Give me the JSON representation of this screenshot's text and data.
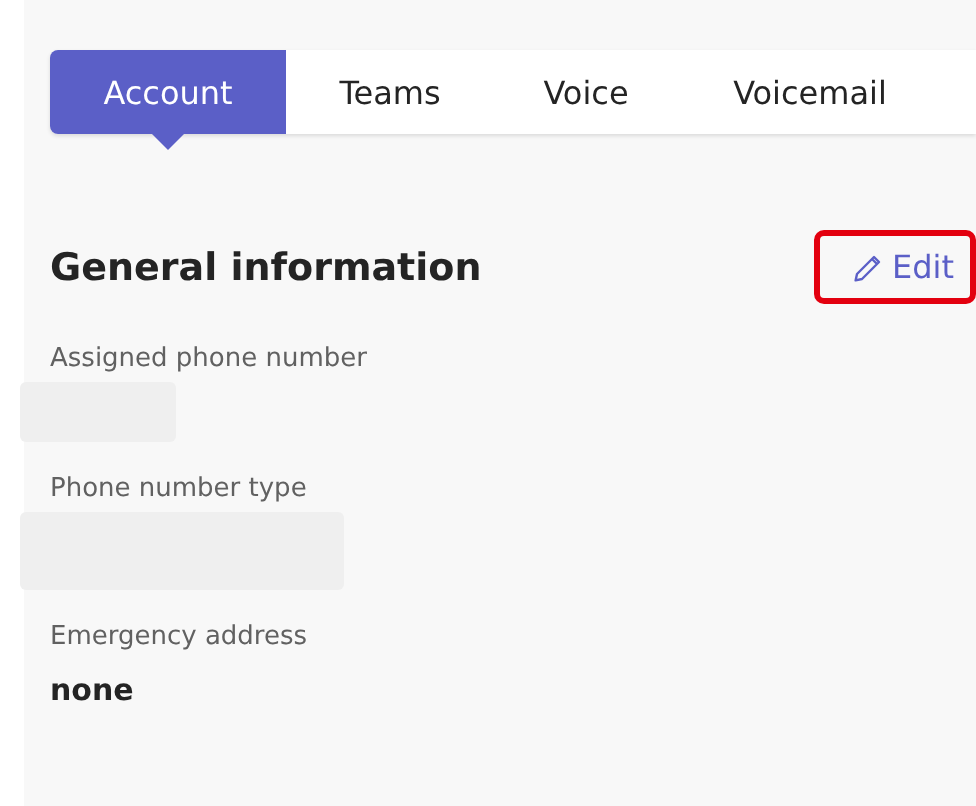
{
  "tabs": [
    {
      "label": "Account",
      "selected": true
    },
    {
      "label": "Teams",
      "selected": false
    },
    {
      "label": "Voice",
      "selected": false
    },
    {
      "label": "Voicemail",
      "selected": false
    }
  ],
  "section": {
    "title": "General information",
    "edit_button": {
      "label": "Edit",
      "highlighted": true
    }
  },
  "fields": [
    {
      "label": "Assigned phone number",
      "kind": "redacted"
    },
    {
      "label": "Phone number type",
      "kind": "redacted"
    },
    {
      "label": "Emergency address",
      "kind": "text",
      "value": "none"
    }
  ]
}
